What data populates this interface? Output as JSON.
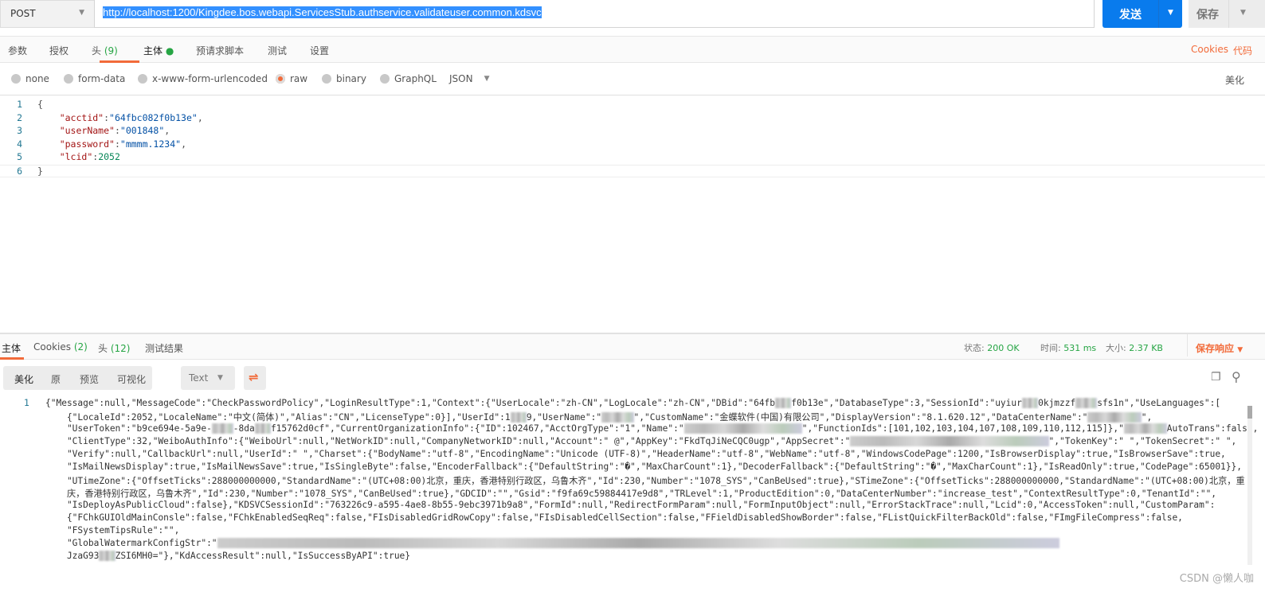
{
  "request": {
    "method": "POST",
    "url": "http://localhost:1200/Kingdee.bos.webapi.ServicesStub.authservice.validateuser.common.kdsvc",
    "send_label": "发送",
    "save_label": "保存",
    "tabs": [
      {
        "label": "参数"
      },
      {
        "label": "授权"
      },
      {
        "label": "头",
        "count": "(9)"
      },
      {
        "label": "主体",
        "active": true
      },
      {
        "label": "预请求脚本"
      },
      {
        "label": "测试"
      },
      {
        "label": "设置"
      }
    ],
    "cookies_link": "Cookies",
    "code_link": "代码",
    "body_types": [
      "none",
      "form-data",
      "x-www-form-urlencoded",
      "raw",
      "binary",
      "GraphQL"
    ],
    "body_selected": "raw",
    "format": "JSON",
    "beautify": "美化",
    "body_lines": [
      {
        "n": "1",
        "text": "{"
      },
      {
        "n": "2",
        "key": "\"acctid\"",
        "val": "\"64fbc082f0b13e\"",
        "tail": ","
      },
      {
        "n": "3",
        "key": "\"userName\"",
        "val": "\"001848\"",
        "tail": ","
      },
      {
        "n": "4",
        "key": "\"password\"",
        "val": "\"mmmm.1234\"",
        "tail": ","
      },
      {
        "n": "5",
        "key": "\"lcid\"",
        "num": "2052",
        "tail": ""
      },
      {
        "n": "6",
        "text": "}"
      }
    ]
  },
  "response": {
    "tabs": [
      {
        "label": "主体",
        "active": true
      },
      {
        "label": "Cookies",
        "count": "(2)"
      },
      {
        "label": "头",
        "count": "(12)"
      },
      {
        "label": "测试结果"
      }
    ],
    "status_label": "状态:",
    "status": "200 OK",
    "time_label": "时间:",
    "time": "531 ms",
    "size_label": "大小:",
    "size": "2.37 KB",
    "save_response": "保存响应",
    "views": [
      "美化",
      "原",
      "预览",
      "可视化"
    ],
    "view_format": "Text",
    "line_number": "1",
    "lines": [
      "{\"Message\":null,\"MessageCode\":\"CheckPasswordPolicy\",\"LoginResultType\":1,\"Context\":{\"UserLocale\":\"zh-CN\",\"LogLocale\":\"zh-CN\",\"DBid\":\"64fb###f0b13e\",\"DatabaseType\":3,\"SessionId\":\"uyiur###0kjmzzf####sfs1n\",\"UseLanguages\":[",
      "    {\"LocaleId\":2052,\"LocaleName\":\"中文(简体)\",\"Alias\":\"CN\",\"LicenseType\":0}],\"UserId\":1###9,\"UserName\":\"######\",\"CustomName\":\"金蝶软件(中国)有限公司\",\"DisplayVersion\":\"8.1.620.12\",\"DataCenterName\":\"##########\",",
      "    \"UserToken\":\"b9ce694e-5a9e-####-8da###f15762d0cf\",\"CurrentOrganizationInfo\":{\"ID\":102467,\"AcctOrgType\":\"1\",\"Name\":\"######################\",\"FunctionIds\":[101,102,103,104,107,108,109,110,112,115]},\"########AutoTrans\":false,",
      "    \"ClientType\":32,\"WeiboAuthInfo\":{\"WeiboUrl\":null,\"NetWorkID\":null,\"CompanyNetworkID\":null,\"Account\":\" @\",\"AppKey\":\"FkdTqJiNeCQC0ugp\",\"AppSecret\":\"#####################################\",\"TokenKey\":\" \",\"TokenSecret\":\" \",",
      "    \"Verify\":null,\"CallbackUrl\":null,\"UserId\":\" \",\"Charset\":{\"BodyName\":\"utf-8\",\"EncodingName\":\"Unicode (UTF-8)\",\"HeaderName\":\"utf-8\",\"WebName\":\"utf-8\",\"WindowsCodePage\":1200,\"IsBrowserDisplay\":true,\"IsBrowserSave\":true,",
      "    \"IsMailNewsDisplay\":true,\"IsMailNewsSave\":true,\"IsSingleByte\":false,\"EncoderFallback\":{\"DefaultString\":\"�\",\"MaxCharCount\":1},\"DecoderFallback\":{\"DefaultString\":\"�\",\"MaxCharCount\":1},\"IsReadOnly\":true,\"CodePage\":65001}},",
      "    \"UTimeZone\":{\"OffsetTicks\":288000000000,\"StandardName\":\"(UTC+08:00)北京，重庆，香港特别行政区，乌鲁木齐\",\"Id\":230,\"Number\":\"1078_SYS\",\"CanBeUsed\":true},\"STimeZone\":{\"OffsetTicks\":288000000000,\"StandardName\":\"(UTC+08:00)北京，重",
      "    庆，香港特别行政区，乌鲁木齐\",\"Id\":230,\"Number\":\"1078_SYS\",\"CanBeUsed\":true},\"GDCID\":\"\",\"Gsid\":\"f9fa69c59884417e9d8\",\"TRLevel\":1,\"ProductEdition\":0,\"DataCenterNumber\":\"increase_test\",\"ContextResultType\":0,\"TenantId\":\"\",",
      "    \"IsDeployAsPublicCloud\":false},\"KDSVCSessionId\":\"763226c9-a595-4ae8-8b55-9ebc3971b9a8\",\"FormId\":null,\"RedirectFormParam\":null,\"FormInputObject\":null,\"ErrorStackTrace\":null,\"Lcid\":0,\"AccessToken\":null,\"CustomParam\":",
      "    {\"FChkGUIOldMainConsle\":false,\"FChkEnabledSeqReq\":false,\"FIsDisabledGridRowCopy\":false,\"FIsDisabledCellSection\":false,\"FFieldDisabledShowBorder\":false,\"FListQuickFilterBackOld\":false,\"FImgFileCompress\":false,",
      "    \"FSystemTipsRule\":\"\",",
      "    \"GlobalWatermarkConfigStr\":\"#############################################################################################################################################################",
      "    JzaG93###ZSI6MH0=\"},\"KdAccessResult\":null,\"IsSuccessByAPI\":true}"
    ]
  },
  "watermark": "CSDN @懒人咖",
  "colors": {
    "accent": "#f26b3a",
    "send": "#097bed",
    "ok": "#26a544"
  }
}
